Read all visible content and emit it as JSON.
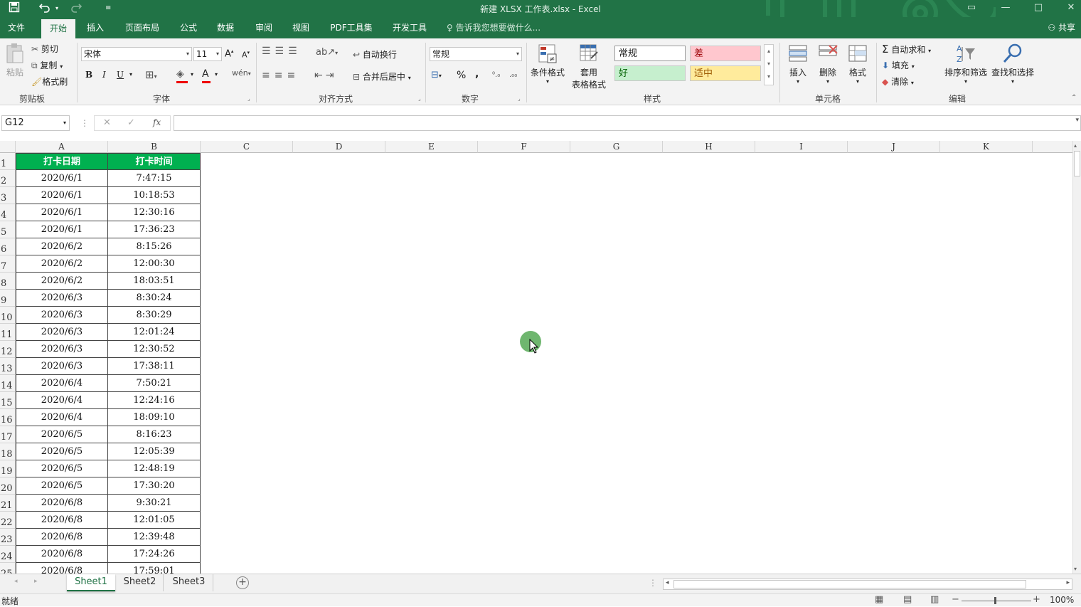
{
  "window": {
    "title": "新建 XLSX 工作表.xlsx - Excel",
    "accent": "#217346"
  },
  "quick_access": {
    "save_icon": "save-icon",
    "undo_icon": "undo-icon",
    "redo_icon": "redo-icon",
    "customize_icon": "customize-qat-icon"
  },
  "tabs": [
    "文件",
    "开始",
    "插入",
    "页面布局",
    "公式",
    "数据",
    "审阅",
    "视图",
    "PDF工具集",
    "开发工具"
  ],
  "active_tab": "开始",
  "tell_me": "告诉我您想要做什么...",
  "share": "共享",
  "ribbon": {
    "clipboard": {
      "paste": "粘贴",
      "cut": "剪切",
      "copy": "复制",
      "format_painter": "格式刷",
      "group": "剪贴板"
    },
    "font": {
      "name": "宋体",
      "size": "11",
      "group": "字体",
      "bold": "B",
      "italic": "I",
      "underline": "U"
    },
    "alignment": {
      "wrap": "自动换行",
      "merge": "合并后居中",
      "group": "对齐方式"
    },
    "number": {
      "format": "常规",
      "percent": "%",
      "comma": ",",
      "group": "数字"
    },
    "styles": {
      "conditional": "条件格式",
      "table_line1": "套用",
      "table_line2": "表格格式",
      "normal": "常规",
      "bad": "差",
      "good": "好",
      "neutral": "适中",
      "group": "样式"
    },
    "cells": {
      "insert": "插入",
      "delete": "删除",
      "format": "格式",
      "group": "单元格"
    },
    "editing": {
      "autosum": "自动求和",
      "fill": "填充",
      "clear": "清除",
      "sort": "排序和筛选",
      "find": "查找和选择",
      "group": "编辑"
    }
  },
  "formula_bar": {
    "name_box": "G12",
    "fx": "fx",
    "cancel": "✕",
    "enter": "✓",
    "content": ""
  },
  "columns": [
    "A",
    "B",
    "C",
    "D",
    "E",
    "F",
    "G",
    "H",
    "I",
    "J",
    "K"
  ],
  "table": {
    "headers": [
      "打卡日期",
      "打卡时间"
    ],
    "header_color": "#00b050",
    "rows": [
      [
        "2020/6/1",
        "7:47:15"
      ],
      [
        "2020/6/1",
        "10:18:53"
      ],
      [
        "2020/6/1",
        "12:30:16"
      ],
      [
        "2020/6/1",
        "17:36:23"
      ],
      [
        "2020/6/2",
        "8:15:26"
      ],
      [
        "2020/6/2",
        "12:00:30"
      ],
      [
        "2020/6/2",
        "18:03:51"
      ],
      [
        "2020/6/3",
        "8:30:24"
      ],
      [
        "2020/6/3",
        "8:30:29"
      ],
      [
        "2020/6/3",
        "12:01:24"
      ],
      [
        "2020/6/3",
        "12:30:52"
      ],
      [
        "2020/6/3",
        "17:38:11"
      ],
      [
        "2020/6/4",
        "7:50:21"
      ],
      [
        "2020/6/4",
        "12:24:16"
      ],
      [
        "2020/6/4",
        "18:09:10"
      ],
      [
        "2020/6/5",
        "8:16:23"
      ],
      [
        "2020/6/5",
        "12:05:39"
      ],
      [
        "2020/6/5",
        "12:48:19"
      ],
      [
        "2020/6/5",
        "17:30:20"
      ],
      [
        "2020/6/8",
        "9:30:21"
      ],
      [
        "2020/6/8",
        "12:01:05"
      ],
      [
        "2020/6/8",
        "12:39:48"
      ],
      [
        "2020/6/8",
        "17:24:26"
      ],
      [
        "2020/6/8",
        "17:59:01"
      ]
    ]
  },
  "sheets": [
    "Sheet1",
    "Sheet2",
    "Sheet3"
  ],
  "active_sheet": "Sheet1",
  "status": {
    "ready": "就绪",
    "zoom": "100%"
  }
}
